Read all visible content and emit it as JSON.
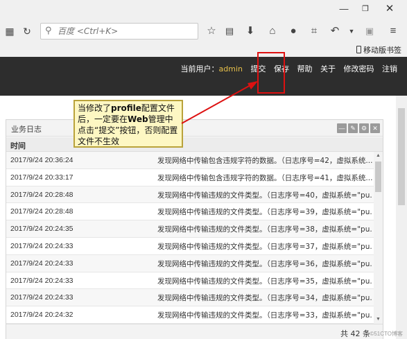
{
  "browser": {
    "search_placeholder": "百度 <Ctrl+K>",
    "bookmarks_label": "移动版书签",
    "window_controls": [
      "minimize-icon",
      "restore-icon",
      "close-icon"
    ],
    "toolbar_icons": [
      "qr-icon",
      "reload-icon",
      "search-icon",
      "star-icon",
      "reader-icon",
      "download-icon",
      "home-icon",
      "chat-icon",
      "crop-icon",
      "back-icon",
      "dropdown-icon",
      "screenshot-icon",
      "menu-icon"
    ]
  },
  "header": {
    "current_user_label": "当前用户：",
    "username": "admin",
    "nav": {
      "submit": "提交",
      "save": "保存",
      "help": "帮助",
      "about": "关于",
      "change_password": "修改密码",
      "logout": "注销"
    }
  },
  "panel": {
    "title": "业务日志",
    "column_time": "时间",
    "rows": [
      {
        "time": "2017/9/24 20:36:24",
        "msg": "发现网络中传输包含违规字符的数据。（日志序号=42，虚拟系统..."
      },
      {
        "time": "2017/9/24 20:33:17",
        "msg": "发现网络中传输包含违规字符的数据。（日志序号=41，虚拟系统..."
      },
      {
        "time": "2017/9/24 20:28:48",
        "msg": "发现网络中传输违规的文件类型。（日志序号=40，虚拟系统=\"pu..."
      },
      {
        "time": "2017/9/24 20:28:48",
        "msg": "发现网络中传输违规的文件类型。（日志序号=39，虚拟系统=\"pu..."
      },
      {
        "time": "2017/9/24 20:24:35",
        "msg": "发现网络中传输违规的文件类型。（日志序号=38，虚拟系统=\"pu..."
      },
      {
        "time": "2017/9/24 20:24:33",
        "msg": "发现网络中传输违规的文件类型。（日志序号=37，虚拟系统=\"pu..."
      },
      {
        "time": "2017/9/24 20:24:33",
        "msg": "发现网络中传输违规的文件类型。（日志序号=36，虚拟系统=\"pu..."
      },
      {
        "time": "2017/9/24 20:24:33",
        "msg": "发现网络中传输违规的文件类型。（日志序号=35，虚拟系统=\"pu..."
      },
      {
        "time": "2017/9/24 20:24:33",
        "msg": "发现网络中传输违规的文件类型。（日志序号=34，虚拟系统=\"pu..."
      },
      {
        "time": "2017/9/24 20:24:32",
        "msg": "发现网络中传输违规的文件类型。（日志序号=33，虚拟系统=\"pu..."
      }
    ],
    "total": "共 42 条"
  },
  "callout": {
    "line1_a": "当修改了",
    "line1_b": "profile",
    "line1_c": "配置文件后，一定要在",
    "line2_b": "Web",
    "line2_c": "管理中点击“提交”按钮，否则配置文件不生效"
  },
  "watermark": "©51CTO博客",
  "colors": {
    "header_bg": "#2d2d2d",
    "username": "#e7c04a",
    "callout_bg": "#fdf7c3",
    "highlight_red": "#dd1111"
  }
}
